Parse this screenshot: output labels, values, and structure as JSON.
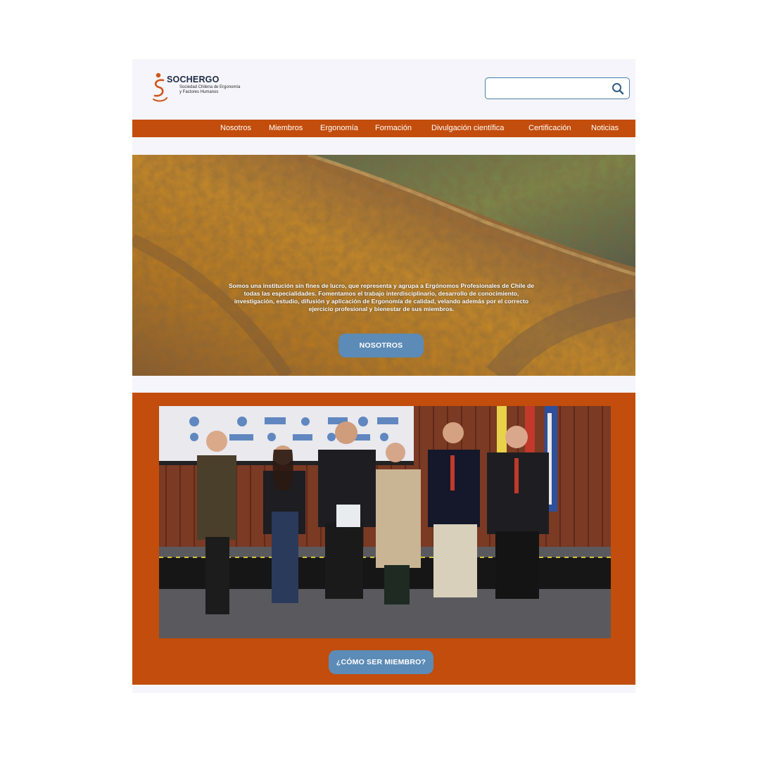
{
  "header": {
    "logo": {
      "name": "SOCHERGO",
      "tagline": "Sociedad Chilena de Ergonomía y Factores Humanos"
    },
    "search": {
      "placeholder": "",
      "value": ""
    }
  },
  "nav": {
    "items": [
      {
        "label": "Nosotros"
      },
      {
        "label": "Miembros"
      },
      {
        "label": "Ergonomía"
      },
      {
        "label": "Formación"
      },
      {
        "label": "Divulgación científica"
      },
      {
        "label": "Certificación"
      },
      {
        "label": "Noticias"
      }
    ]
  },
  "hero": {
    "text": "Somos una institución sin fines de lucro, que representa y agrupa a Ergónomos Profesionales de Chile de todas las especialidades. Fomentamos el trabajo interdisciplinario, desarrollo de conocimiento, investigación, estudio, difusión y aplicación de Ergonomía de calidad, velando además por el correcto ejercicio profesional y bienestar de sus miembros.",
    "button_label": "NOSOTROS"
  },
  "members_section": {
    "button_label": "¿CÓMO SER MIEMBRO?"
  },
  "colors": {
    "brand_orange": "#c24d0c",
    "button_blue": "#5b8bb6",
    "page_bg": "#f5f5fb",
    "search_border": "#4f7fa8"
  },
  "icons": {
    "search": "search-icon",
    "logo": "logo-icon"
  }
}
